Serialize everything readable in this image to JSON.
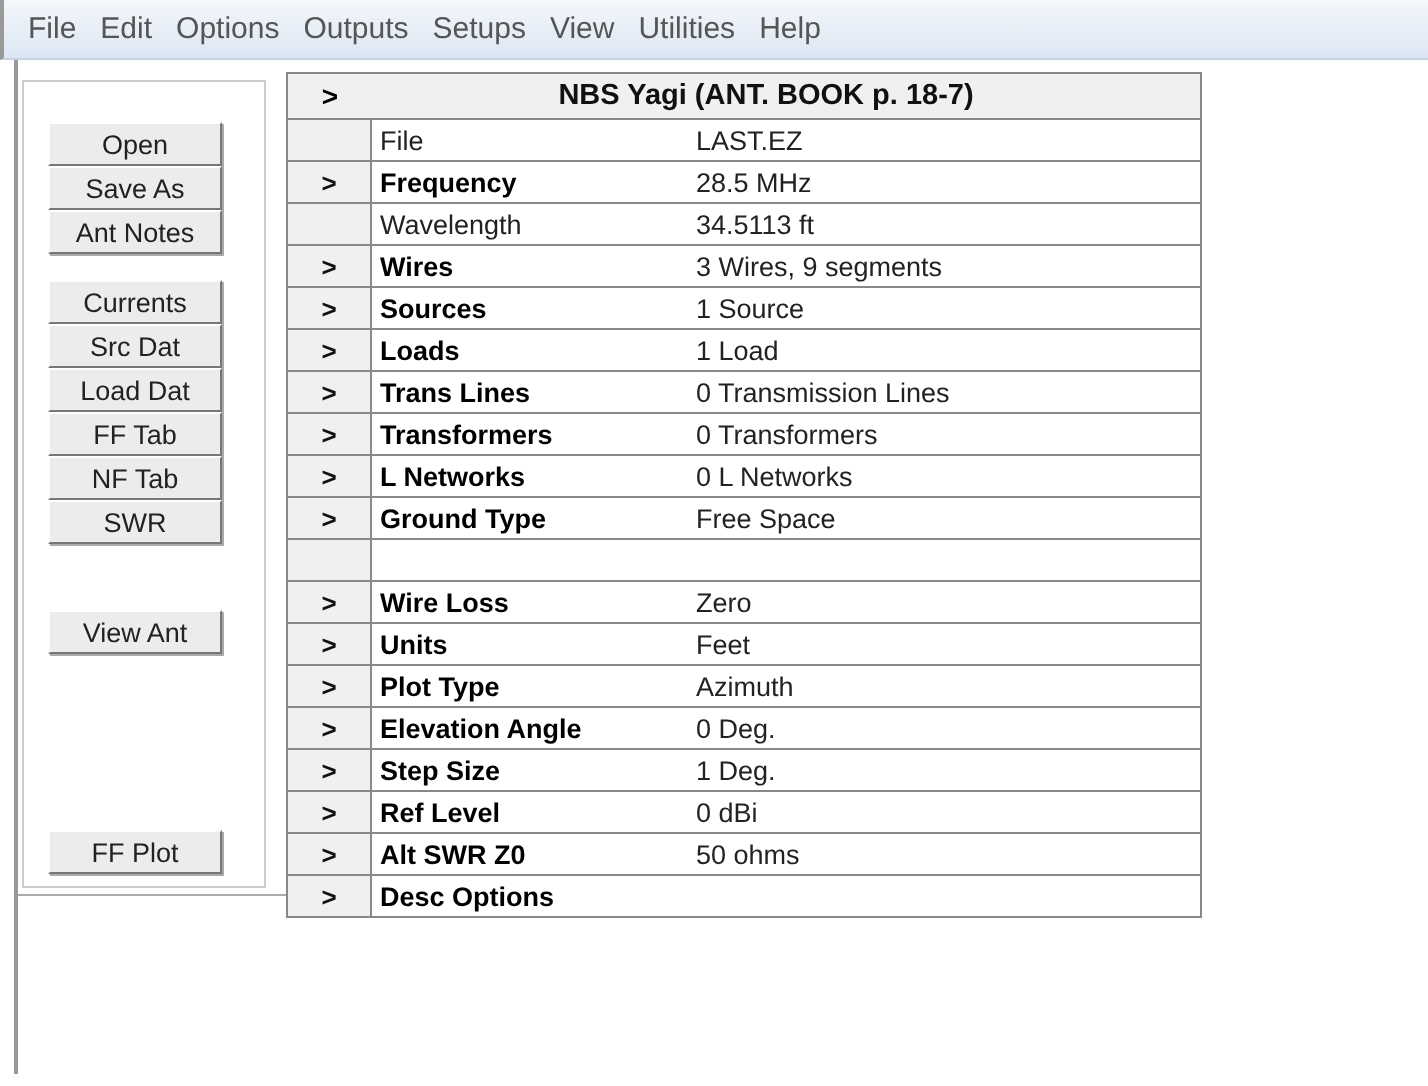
{
  "menu": [
    "File",
    "Edit",
    "Options",
    "Outputs",
    "Setups",
    "View",
    "Utilities",
    "Help"
  ],
  "side_button_groups": [
    [
      "Open",
      "Save As",
      "Ant Notes"
    ],
    [
      "Currents",
      "Src Dat",
      "Load Dat",
      "FF Tab",
      "NF Tab",
      "SWR"
    ],
    [
      "View Ant"
    ],
    [
      "FF Plot"
    ]
  ],
  "grid": {
    "header_button": ">",
    "title": "NBS Yagi (ANT. BOOK p. 18-7)",
    "rows": [
      {
        "kind": "info",
        "label": "File",
        "value": "LAST.EZ"
      },
      {
        "kind": "setting",
        "button": ">",
        "label": "Frequency",
        "value": "28.5 MHz"
      },
      {
        "kind": "info",
        "label": "Wavelength",
        "value": "34.5113 ft"
      },
      {
        "kind": "setting",
        "button": ">",
        "label": "Wires",
        "value": "3 Wires, 9 segments"
      },
      {
        "kind": "setting",
        "button": ">",
        "label": "Sources",
        "value": "1 Source"
      },
      {
        "kind": "setting",
        "button": ">",
        "label": "Loads",
        "value": "1 Load"
      },
      {
        "kind": "setting",
        "button": ">",
        "label": "Trans Lines",
        "value": "0 Transmission Lines"
      },
      {
        "kind": "setting",
        "button": ">",
        "label": "Transformers",
        "value": "0 Transformers"
      },
      {
        "kind": "setting",
        "button": ">",
        "label": "L Networks",
        "value": "0 L Networks"
      },
      {
        "kind": "setting",
        "button": ">",
        "label": "Ground Type",
        "value": "Free Space"
      },
      {
        "kind": "spacer"
      },
      {
        "kind": "setting",
        "button": ">",
        "label": "Wire Loss",
        "value": "Zero"
      },
      {
        "kind": "setting",
        "button": ">",
        "label": "Units",
        "value": "Feet"
      },
      {
        "kind": "setting",
        "button": ">",
        "label": "Plot Type",
        "value": "Azimuth"
      },
      {
        "kind": "setting",
        "button": ">",
        "label": "Elevation Angle",
        "value": "0 Deg."
      },
      {
        "kind": "setting",
        "button": ">",
        "label": "Step Size",
        "value": "1 Deg."
      },
      {
        "kind": "setting",
        "button": ">",
        "label": "Ref Level",
        "value": "0 dBi"
      },
      {
        "kind": "setting",
        "button": ">",
        "label": "Alt SWR Z0",
        "value": "50 ohms"
      },
      {
        "kind": "setting",
        "button": ">",
        "label": "Desc Options"
      }
    ]
  }
}
